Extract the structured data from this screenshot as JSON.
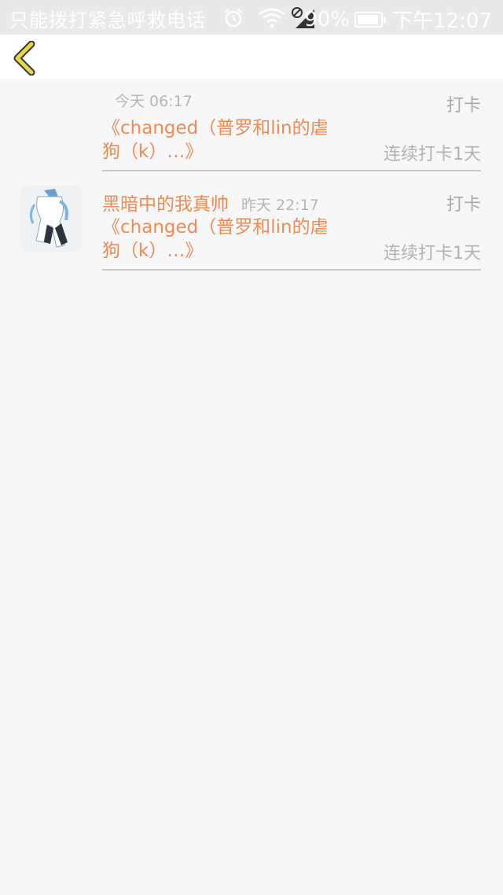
{
  "status_bar": {
    "carrier_text": "只能拨打紧急呼救电话",
    "battery_text": "90%",
    "clock": "下午12:07",
    "icons": [
      "alarm-icon",
      "wifi-icon",
      "no-sim-signal-icon",
      "battery-icon"
    ],
    "battery_level": 0.9
  },
  "header": {
    "back_icon": "chevron-left-icon",
    "accent": "#e8d54a"
  },
  "checkins": [
    {
      "name": "",
      "time": "今天 06:17",
      "action": "打卡",
      "book": "《changed（普罗和lin的虐狗（k）…》",
      "streak": "连续打卡1天",
      "has_avatar": false
    },
    {
      "name": "黑暗中的我真帅",
      "time": "昨天 22:17",
      "action": "打卡",
      "book": "《changed（普罗和lin的虐狗（k）…》",
      "streak": "连续打卡1天",
      "has_avatar": true
    }
  ],
  "colors": {
    "accent_orange": "#ee8a54",
    "muted_gray": "#b5b5b5",
    "background": "#f7f7f7"
  }
}
